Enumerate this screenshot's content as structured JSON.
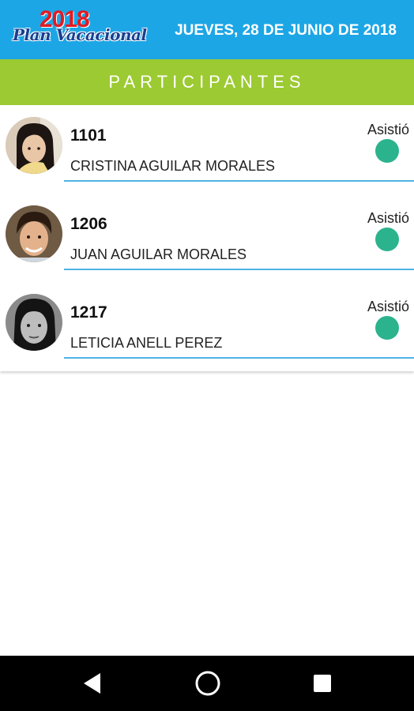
{
  "header": {
    "logo_year": "2018",
    "logo_brand": "Plan Vacacional",
    "date": "JUEVES, 28 DE JUNIO DE 2018",
    "background": "#1da6e5"
  },
  "section": {
    "title": "PARTICIPANTES",
    "background": "#9cca32"
  },
  "participants": [
    {
      "id": "1101",
      "name": "CRISTINA AGUILAR MORALES",
      "status": "Asistió",
      "status_color": "#2bb38e",
      "avatar": "avatar-photo-girl"
    },
    {
      "id": "1206",
      "name": "JUAN AGUILAR MORALES",
      "status": "Asistió",
      "status_color": "#2bb38e",
      "avatar": "avatar-photo-boy"
    },
    {
      "id": "1217",
      "name": "LETICIA ANELL PEREZ",
      "status": "Asistió",
      "status_color": "#2bb38e",
      "avatar": "avatar-photo-girl-bw"
    }
  ],
  "navigation": {
    "back_icon": "back-triangle-icon",
    "home_icon": "home-circle-icon",
    "recent_icon": "recent-square-icon"
  }
}
